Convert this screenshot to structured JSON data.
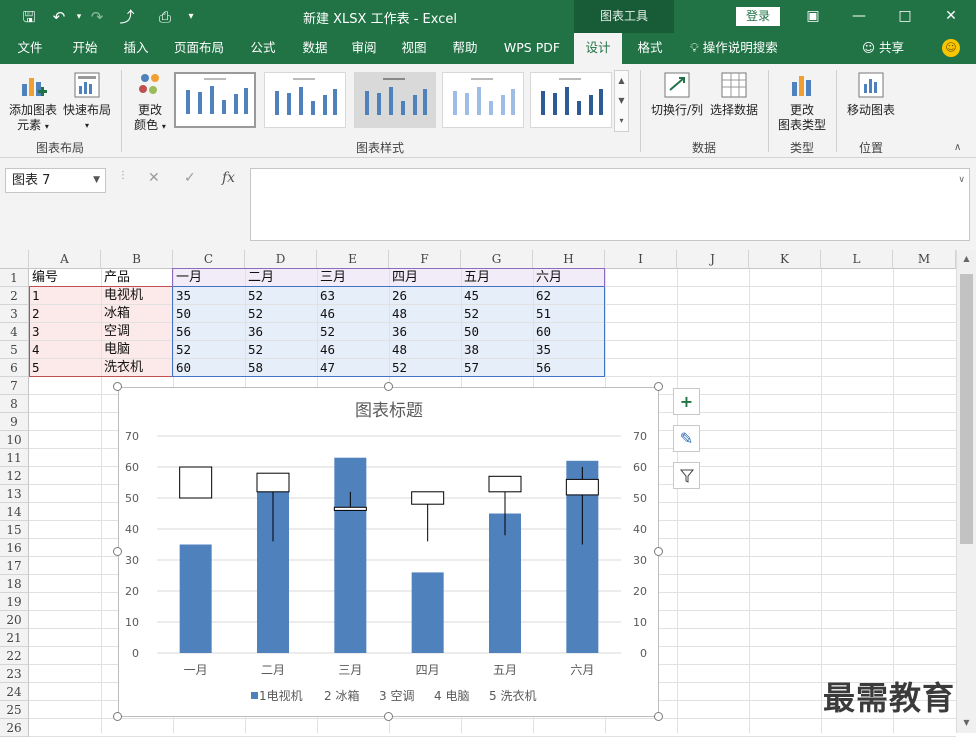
{
  "titlebar": {
    "doc_title": "新建 XLSX 工作表  -  Excel",
    "context_tab": "图表工具",
    "login": "登录"
  },
  "tabs": [
    {
      "label": "文件"
    },
    {
      "label": "开始"
    },
    {
      "label": "插入"
    },
    {
      "label": "页面布局"
    },
    {
      "label": "公式"
    },
    {
      "label": "数据"
    },
    {
      "label": "审阅"
    },
    {
      "label": "视图"
    },
    {
      "label": "帮助"
    },
    {
      "label": "WPS PDF"
    },
    {
      "label": "设计"
    },
    {
      "label": "格式"
    }
  ],
  "tell_me": "操作说明搜索",
  "share": "共享",
  "ribbon": {
    "add_element_1": "添加图表",
    "add_element_2": "元素",
    "quick_layout": "快速布局",
    "change_colors_1": "更改",
    "change_colors_2": "颜色",
    "group_layout": "图表布局",
    "group_styles": "图表样式",
    "switch_row_col": "切换行/列",
    "select_data": "选择数据",
    "group_data": "数据",
    "change_type_1": "更改",
    "change_type_2": "图表类型",
    "group_type": "类型",
    "move_chart": "移动图表",
    "group_location": "位置"
  },
  "formula_bar": {
    "name_box": "图表 7",
    "fx": "fx"
  },
  "sheet": {
    "columns": [
      "A",
      "B",
      "C",
      "D",
      "E",
      "F",
      "G",
      "H",
      "I",
      "J",
      "K",
      "L",
      "M"
    ],
    "rows": [
      "1",
      "2",
      "3",
      "4",
      "5",
      "6",
      "7",
      "8",
      "9",
      "10",
      "11",
      "12",
      "13",
      "14",
      "15",
      "16",
      "17",
      "18",
      "19",
      "20",
      "21",
      "22",
      "23",
      "24",
      "25",
      "26"
    ],
    "header": [
      "编号",
      "产品",
      "一月",
      "二月",
      "三月",
      "四月",
      "五月",
      "六月"
    ],
    "data": [
      [
        "1",
        "电视机",
        "35",
        "52",
        "63",
        "26",
        "45",
        "62"
      ],
      [
        "2",
        "冰箱",
        "50",
        "52",
        "46",
        "48",
        "52",
        "51"
      ],
      [
        "3",
        "空调",
        "56",
        "36",
        "52",
        "36",
        "50",
        "60"
      ],
      [
        "4",
        "电脑",
        "52",
        "52",
        "46",
        "48",
        "38",
        "35"
      ],
      [
        "5",
        "洗衣机",
        "60",
        "58",
        "47",
        "52",
        "57",
        "56"
      ]
    ]
  },
  "chart_data": {
    "type": "bar",
    "title": "图表标题",
    "categories": [
      "一月",
      "二月",
      "三月",
      "四月",
      "五月",
      "六月"
    ],
    "ylim": [
      0,
      70
    ],
    "yticks": [
      0,
      10,
      20,
      30,
      40,
      50,
      60,
      70
    ],
    "series": [
      {
        "name": "1电视机",
        "values": [
          35,
          52,
          63,
          26,
          45,
          62
        ],
        "render": "column",
        "color": "#4f81bd"
      }
    ],
    "stock_series": {
      "open": [
        50,
        52,
        46,
        48,
        52,
        51
      ],
      "high": [
        56,
        36,
        52,
        36,
        50,
        60
      ],
      "low": [
        52,
        52,
        46,
        48,
        38,
        35
      ],
      "close": [
        60,
        58,
        47,
        52,
        57,
        56
      ]
    },
    "legend": [
      "1电视机",
      "2 冰箱",
      "3 空调",
      "4 电脑",
      "5 洗衣机"
    ],
    "legend_position": "bottom",
    "grid": true
  },
  "watermark": "最需教育"
}
